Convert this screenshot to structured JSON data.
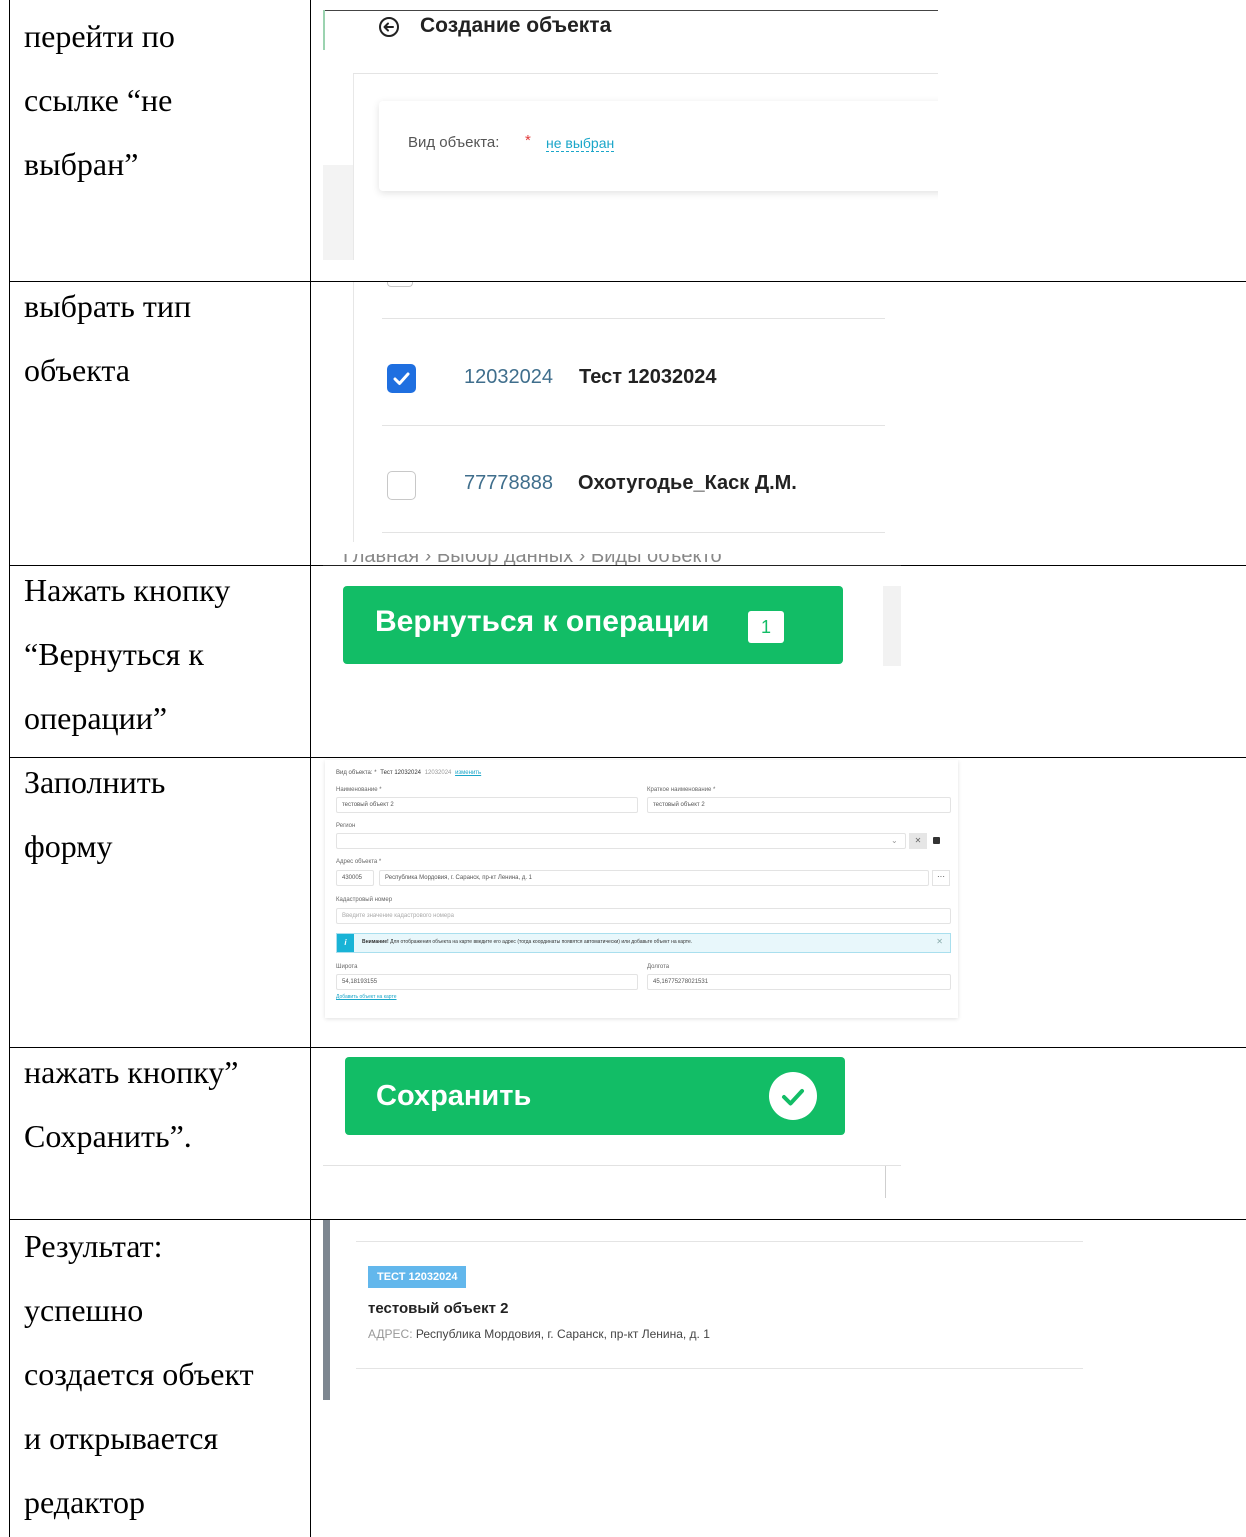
{
  "rows": [
    {
      "instruction": [
        "перейти по",
        "ссылке “не",
        "выбран”"
      ],
      "screen": {
        "back_icon": "arrow-left-circle-icon",
        "title": "Создание объекта",
        "field_label": "Вид объекта:",
        "required_mark": "*",
        "link_text": "не выбран"
      }
    },
    {
      "instruction": [
        "выбрать тип",
        "объекта"
      ],
      "screen": {
        "items": [
          {
            "code": "12032024",
            "name": "Тест 12032024",
            "checked": true
          },
          {
            "code": "77778888",
            "name": "Охотугодье_Каск Д.М.",
            "checked": false
          }
        ]
      }
    },
    {
      "instruction": [
        "Нажать кнопку",
        "“Вернуться к",
        "операции”"
      ],
      "screen": {
        "cut_breadcrumb": "Главная  ›  Выбор данных  ›  Виды объекто",
        "button_label": "Вернуться к операции",
        "badge": "1"
      }
    },
    {
      "instruction": [
        "Заполнить",
        "форму"
      ],
      "screen": {
        "kind_label": "Вид объекта: *",
        "kind_value": "Тест 12032024",
        "kind_code": "12032024",
        "kind_change": "изменить",
        "name_label": "Наименование *",
        "name_value": "тестовый объект 2",
        "short_label": "Краткое наименование *",
        "short_value": "тестовый объект 2",
        "region_label": "Регион",
        "address_label": "Адрес объекта *",
        "postcode": "430005",
        "address_value": "Республика Мордовия, г. Саранск, пр-кт Ленина, д. 1",
        "cadastral_label": "Кадастровый номер",
        "cadastral_placeholder": "Введите значение кадастрового номера",
        "notice_bold": "Внимание!",
        "notice_text": "Для отображения объекта на карте введите его адрес (тогда координаты появятся автоматически) или добавьте объект на карте.",
        "lat_label": "Широта",
        "lat_value": "54,18193155",
        "lon_label": "Долгота",
        "lon_value": "45,16775278021531",
        "map_link": "Добавить объект на карте"
      }
    },
    {
      "instruction": [
        "нажать кнопку”",
        "Сохранить”."
      ],
      "screen": {
        "button_label": "Сохранить",
        "check_icon": "check-circle-icon"
      }
    },
    {
      "instruction": [
        "Результат:",
        "успешно",
        "создается объект",
        "и открывается",
        "редактор"
      ],
      "screen": {
        "tag": "ТЕСТ 12032024",
        "object_name": "тестовый объект 2",
        "address_label": "АДРЕС:",
        "address_value": "Республика Мордовия, г. Саранск, пр-кт Ленина, д. 1"
      }
    }
  ]
}
